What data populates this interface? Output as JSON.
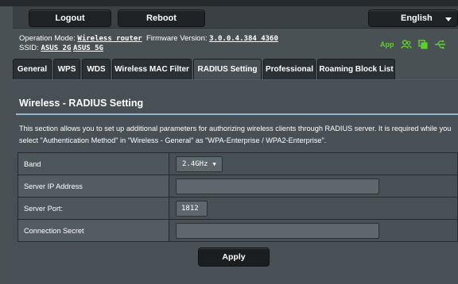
{
  "topbar": {
    "logout_label": "Logout",
    "reboot_label": "Reboot",
    "language": "English"
  },
  "info": {
    "operation_mode_label": "Operation Mode:",
    "operation_mode_value": "Wireless router",
    "firmware_label": "Firmware Version:",
    "firmware_value": "3.0.0.4.384_4360",
    "ssid_label": "SSID:",
    "ssid_values": [
      "ASUS_2G",
      "ASUS_5G"
    ]
  },
  "status": {
    "app_label": "App",
    "icons": [
      "users-icon",
      "copy-icon",
      "usb-icon"
    ],
    "accent": "#5cd02c"
  },
  "tabs": [
    {
      "label": "General",
      "active": false
    },
    {
      "label": "WPS",
      "active": false
    },
    {
      "label": "WDS",
      "active": false
    },
    {
      "label": "Wireless MAC Filter",
      "active": false
    },
    {
      "label": "RADIUS Setting",
      "active": true
    },
    {
      "label": "Professional",
      "active": false
    },
    {
      "label": "Roaming Block List",
      "active": false
    }
  ],
  "panel": {
    "title": "Wireless - RADIUS Setting",
    "description": "This section allows you to set up additional parameters for authorizing wireless clients through RADIUS server. It is required while you select \"Authentication Method\" in \"Wireless - General\" as \"WPA-Enterprise / WPA2-Enterprise\"."
  },
  "settings": {
    "band": {
      "label": "Band",
      "value": "2.4GHz"
    },
    "server_ip": {
      "label": "Server IP Address",
      "value": ""
    },
    "server_port": {
      "label": "Server Port:",
      "value": "1812"
    },
    "secret": {
      "label": "Connection Secret",
      "value": ""
    }
  },
  "apply_label": "Apply"
}
